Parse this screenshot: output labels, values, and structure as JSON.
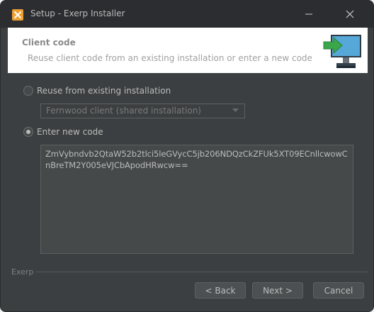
{
  "window": {
    "title": "Setup - Exerp Installer"
  },
  "header": {
    "title": "Client code",
    "subtitle": "Reuse client code from an existing installation or enter a new code",
    "icon": "computer-arrow-icon"
  },
  "options": {
    "reuse_label": "Reuse from existing installation",
    "reuse_checked": false,
    "reuse_select_value": "Fernwood client (shared installation)",
    "new_label": "Enter new code",
    "new_checked": true
  },
  "code": {
    "value": "ZmVybndvb2QtaW52b2tlci5leGVycC5jb206NDQzCkZFUk5XT09ECnllcwowCnBreTM2Y005eVJCbApodHRwcw=="
  },
  "footer": {
    "brand": "Exerp",
    "back_label": "< Back",
    "next_label": "Next >",
    "cancel_label": "Cancel"
  },
  "colors": {
    "window_bg": "#3c3f41",
    "titlebar_bg": "#2b2d30",
    "header_bg": "#ffffff",
    "text": "#bbbbbb",
    "app_icon": "#f0a030",
    "monitor_green": "#3aa84a"
  }
}
